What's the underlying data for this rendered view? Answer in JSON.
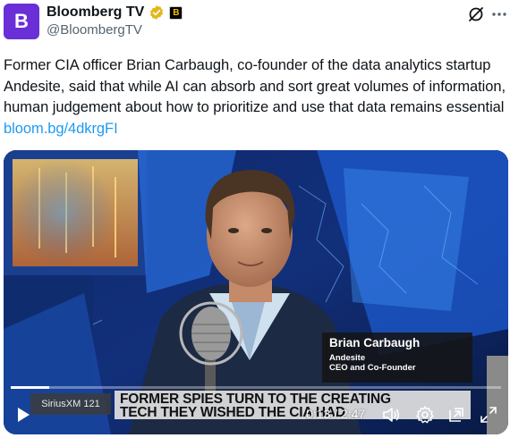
{
  "author": {
    "avatar_letter": "B",
    "display_name": "Bloomberg TV",
    "handle": "@BloombergTV",
    "affiliate_letter": "B"
  },
  "tweet": {
    "text": "Former CIA officer Brian Carbaugh, co-founder of the data analytics startup Andesite, said that while AI can absorb and sort great volumes of information, human judgement about how to prioritize and use that data remains essential ",
    "link_text": "bloom.bg/4dkrgFI"
  },
  "video": {
    "lower_third": {
      "name": "Brian Carbaugh",
      "organization": "Andesite",
      "role": "CEO and Co-Founder"
    },
    "channel_label": "SiriusXM 121",
    "ticker_line1": "FORMER SPIES TURN TO THE CREATING",
    "ticker_line2": "TECH THEY WISHED THE CIA HAD",
    "current_time": "0:13",
    "duration": "2:47",
    "time_display": "0:13 / 2:47",
    "progress_fraction": 0.078
  },
  "colors": {
    "link": "#1d9bf0",
    "avatar_bg": "#6a2fd6",
    "verified": "#e2b719",
    "handle": "#536471"
  },
  "icons": [
    "verified-badge-icon",
    "affiliate-badge-icon",
    "grok-icon",
    "more-icon",
    "play-icon",
    "volume-icon",
    "settings-icon",
    "pip-icon",
    "fullscreen-icon"
  ]
}
